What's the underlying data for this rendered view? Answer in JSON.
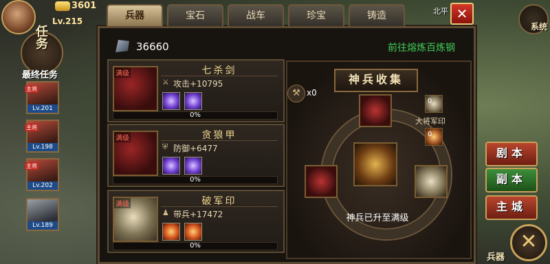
{
  "hud": {
    "gold": "3601",
    "level": "Lv.215",
    "quest_label": "任务",
    "final_quest": "最终任务",
    "generals": [
      {
        "tag": "主将",
        "level": "Lv.201"
      },
      {
        "tag": "主将",
        "level": "Lv.198"
      },
      {
        "tag": "主将",
        "level": "Lv.202"
      },
      {
        "tag": "",
        "level": "Lv.189"
      }
    ],
    "system_label": "系统",
    "north_label": "北平"
  },
  "tabs": [
    "兵器",
    "宝石",
    "战车",
    "珍宝",
    "铸造"
  ],
  "active_tab": "兵器",
  "resource": {
    "ore_count": "36660",
    "forge_link": "前往熔炼百炼钢"
  },
  "items": [
    {
      "name": "七杀剑",
      "full_tag": "满级",
      "stat": "攻击+10795",
      "progress": "0%",
      "thumb": "red"
    },
    {
      "name": "贪狼甲",
      "full_tag": "满级",
      "stat": "防御+6477",
      "progress": "0%",
      "thumb": "red"
    },
    {
      "name": "破军印",
      "full_tag": "满级",
      "stat": "带兵+17472",
      "progress": "0%",
      "thumb": "white"
    }
  ],
  "collection": {
    "title": "神兵收集",
    "hammer_count": "x0",
    "side_zero_1": "0",
    "side_caption": "大将军印",
    "side_zero_2": "0",
    "maxed_text": "神兵已升至满级"
  },
  "side_buttons": {
    "script": "剧本",
    "dungeon": "副本",
    "main_city": "主城"
  },
  "bottom_weapon": "兵器",
  "colors": {
    "accent_gold": "#c9a25b",
    "forge_green": "#3fcf55",
    "close_red": "#d33527"
  }
}
